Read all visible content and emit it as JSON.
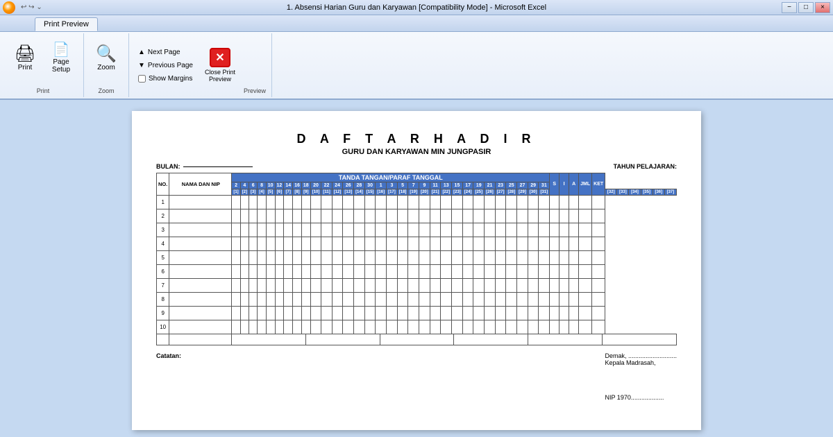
{
  "titlebar": {
    "title": "1. Absensi Harian Guru dan Karyawan  [Compatibility Mode] - Microsoft Excel",
    "min": "−",
    "restore": "□",
    "close": "×"
  },
  "ribbon": {
    "tab": "Print Preview",
    "groups": [
      {
        "name": "Print",
        "buttons": [
          {
            "id": "print",
            "label": "Print",
            "icon": "🖨"
          },
          {
            "id": "page-setup",
            "label": "Page\nSetup",
            "icon": "📄"
          }
        ]
      },
      {
        "name": "Zoom",
        "buttons": [
          {
            "id": "zoom",
            "label": "Zoom",
            "icon": "🔍"
          }
        ]
      },
      {
        "name": "Preview",
        "small_buttons": [
          {
            "id": "next-page",
            "label": "Next Page"
          },
          {
            "id": "previous-page",
            "label": "Previous Page"
          },
          {
            "id": "show-margins",
            "label": "Show Margins",
            "checkbox": true
          }
        ],
        "close_button": {
          "label": "Close Print\nPreview"
        }
      }
    ]
  },
  "document": {
    "title": "D A F T A R   H A D I R",
    "subtitle": "GURU DAN KARYAWAN MIN JUNGPASIR",
    "bulan_label": "BULAN:",
    "bulan_value": "___________",
    "tahun_label": "TAHUN PELAJARAN:",
    "table": {
      "header_main": "TANDA TANGAN/PARAF TANGGAL",
      "col_no": "NO.",
      "col_name": "NAMA DAN NIP",
      "dates_row1": [
        "2",
        "4",
        "6",
        "8",
        "10",
        "12",
        "14",
        "16",
        "18",
        "20",
        "22",
        "24",
        "26",
        "28",
        "30"
      ],
      "dates_row2": [
        "1",
        "3",
        "5",
        "7",
        "9",
        "11",
        "13",
        "15",
        "17",
        "19",
        "21",
        "23",
        "25",
        "27",
        "29",
        "31"
      ],
      "summary_cols": [
        "S",
        "I",
        "A",
        "JML",
        "KET"
      ],
      "header_nums_top": [
        "1",
        "[2]",
        "[3]",
        "[4]",
        "[5]",
        "[6]",
        "[7]",
        "[8]",
        "[9]",
        "[10]",
        "[11]",
        "[12]",
        "[13]",
        "[14]",
        "[15]",
        "[16]",
        "[17]",
        "[18]",
        "[19]",
        "[20]",
        "[21]",
        "[22]",
        "[23]",
        "[24]",
        "[25]",
        "[26]",
        "[27]",
        "[28]",
        "[29]",
        "[30]",
        "[31]",
        "[32]",
        "[33]",
        "[34]",
        "[35]",
        "[36]",
        "[37]"
      ],
      "rows": [
        1,
        2,
        3,
        4,
        5,
        6,
        7,
        8,
        9,
        10
      ]
    },
    "footer": {
      "catatan_label": "Catatan:",
      "demak_text": "Demak, ............................",
      "kepala_text": "Kepala Madrasah,",
      "nip_text": "NIP 1970..................."
    }
  }
}
